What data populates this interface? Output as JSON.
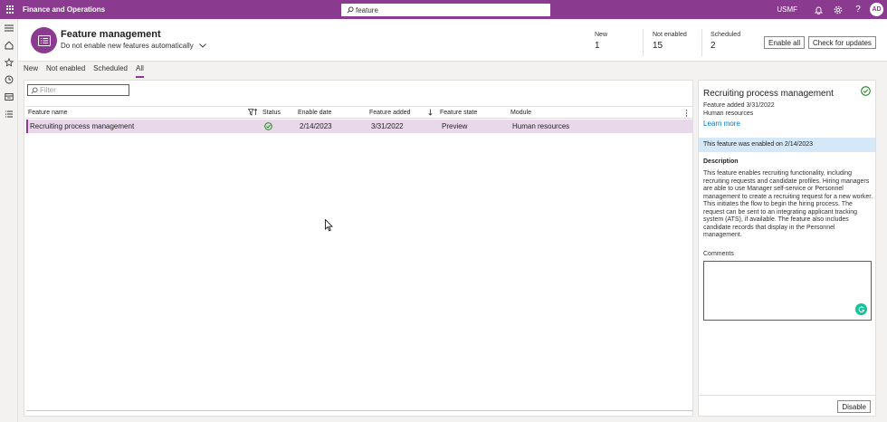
{
  "topbar": {
    "app_title": "Finance and Operations",
    "search_value": "feature",
    "company": "USMF",
    "avatar_initials": "AD",
    "brand_color": "#8a3b8f"
  },
  "leftnav": {
    "icons": [
      "hamburger-icon",
      "home-icon",
      "star-icon",
      "clock-icon",
      "workspace-icon",
      "list-icon"
    ]
  },
  "header": {
    "title": "Feature management",
    "subtitle": "Do not enable new features automatically",
    "stats": [
      {
        "label": "New",
        "value": "1"
      },
      {
        "label": "Not enabled",
        "value": "15"
      },
      {
        "label": "Scheduled",
        "value": "2"
      }
    ],
    "enable_all_label": "Enable all",
    "check_updates_label": "Check for updates"
  },
  "tabs": [
    {
      "label": "New",
      "active": false
    },
    {
      "label": "Not enabled",
      "active": false
    },
    {
      "label": "Scheduled",
      "active": false
    },
    {
      "label": "All",
      "active": true
    }
  ],
  "grid": {
    "filter_placeholder": "Filter",
    "columns": [
      "Feature name",
      "Status",
      "Enable date",
      "Feature added",
      "Feature state",
      "Module"
    ],
    "rows": [
      {
        "name": "Recruiting process management",
        "status": "enabled",
        "enable_date": "2/14/2023",
        "feature_added": "3/31/2022",
        "state": "Preview",
        "module": "Human resources"
      }
    ]
  },
  "pane": {
    "title": "Recruiting process management",
    "feature_added": "Feature added 3/31/2022",
    "module": "Human resources",
    "learn_more": "Learn more",
    "banner": "This feature was enabled on 2/14/2023",
    "description_label": "Description",
    "description": "This feature enables recruiting functionality, including recruiting requests and candidate profiles. Hiring managers are able to use Manager self-service or Personnel management to create a recruiting request for a new worker. This initiates the flow to begin the hiring process. The request can be sent to an integrating applicant tracking system (ATS), if available. The feature also includes candidate records that display in the Personnel management.",
    "comments_label": "Comments",
    "disable_label": "Disable"
  }
}
